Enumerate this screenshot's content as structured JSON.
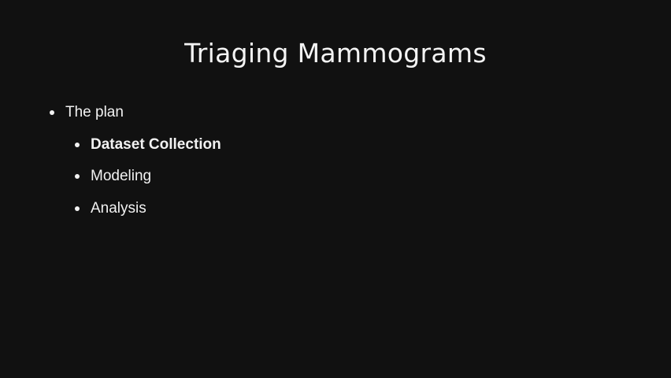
{
  "slide": {
    "title": "Triaging Mammograms",
    "bullets": [
      {
        "text": "The plan",
        "level": 1,
        "bold": false
      },
      {
        "text": "Dataset Collection",
        "level": 2,
        "bold": true
      },
      {
        "text": "Modeling",
        "level": 2,
        "bold": false
      },
      {
        "text": "Analysis",
        "level": 2,
        "bold": false
      }
    ]
  },
  "colors": {
    "background": "#111111",
    "text": "#f2f2f2"
  }
}
